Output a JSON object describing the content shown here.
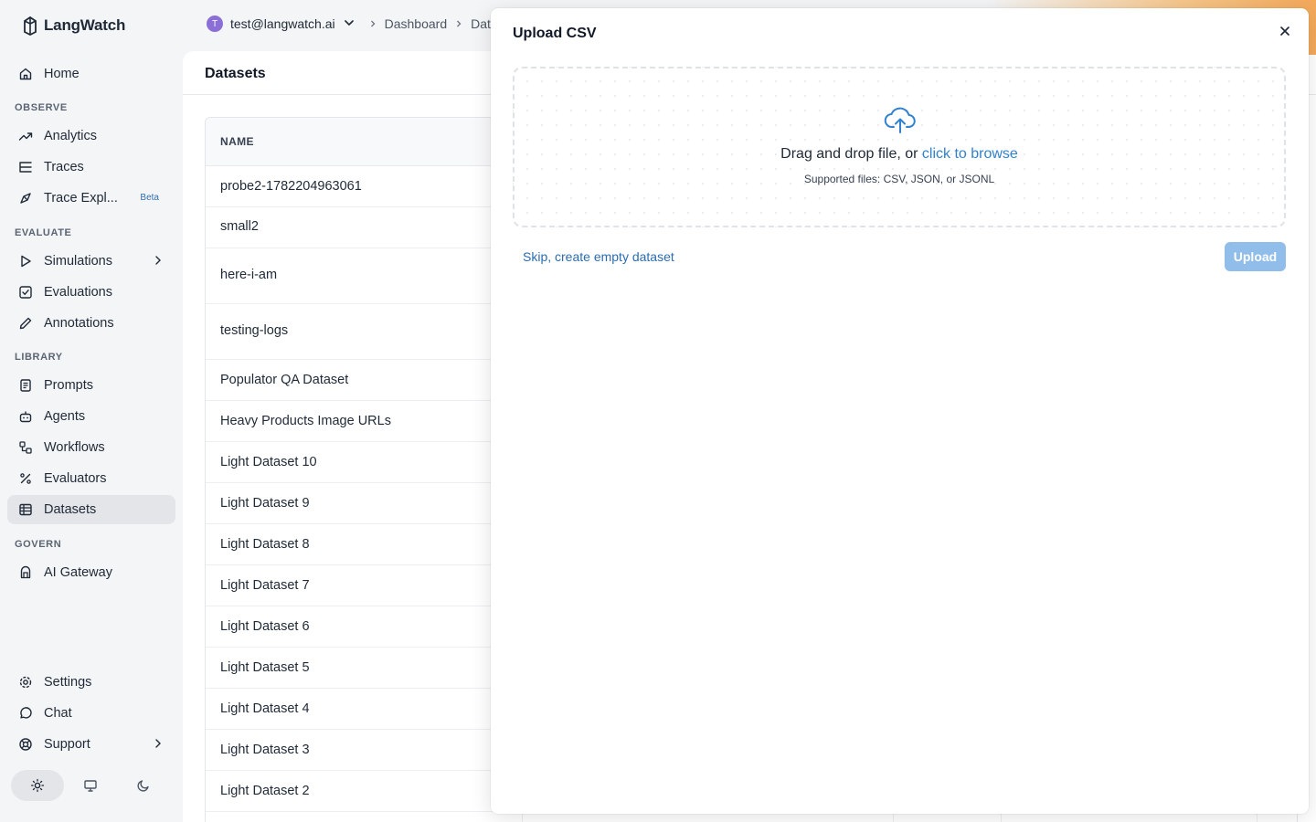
{
  "app": {
    "name": "LangWatch"
  },
  "header": {
    "user_initial": "T",
    "user_email": "test@langwatch.ai",
    "crumbs": [
      "Dashboard",
      "Data"
    ]
  },
  "sidebar": {
    "sections": {
      "observe": "OBSERVE",
      "evaluate": "EVALUATE",
      "library": "LIBRARY",
      "govern": "GOVERN"
    },
    "items": {
      "home": "Home",
      "analytics": "Analytics",
      "traces": "Traces",
      "trace_explorer": "Trace Expl...",
      "trace_explorer_badge": "Beta",
      "simulations": "Simulations",
      "evaluations": "Evaluations",
      "annotations": "Annotations",
      "prompts": "Prompts",
      "agents": "Agents",
      "workflows": "Workflows",
      "evaluators": "Evaluators",
      "datasets": "Datasets",
      "ai_gateway": "AI Gateway",
      "settings": "Settings",
      "chat": "Chat",
      "support": "Support"
    }
  },
  "main": {
    "title": "Datasets",
    "table": {
      "header_name": "NAME",
      "rows": [
        "probe2-1782204963061",
        "small2",
        "here-i-am",
        "testing-logs",
        "Populator QA Dataset",
        "Heavy Products Image URLs",
        "Light Dataset 10",
        "Light Dataset 9",
        "Light Dataset 8",
        "Light Dataset 7",
        "Light Dataset 6",
        "Light Dataset 5",
        "Light Dataset 4",
        "Light Dataset 3",
        "Light Dataset 2"
      ]
    }
  },
  "drawer": {
    "title": "Upload CSV",
    "dropzone_text": "Drag and drop file, or ",
    "dropzone_link": "click to browse",
    "supported": "Supported files: CSV, JSON, or JSONL",
    "skip_link": "Skip, create empty dataset",
    "upload_label": "Upload"
  },
  "colors": {
    "accent": "#3182ce",
    "upload_disabled": "#90bde9",
    "avatar": "#8b6fd6"
  }
}
